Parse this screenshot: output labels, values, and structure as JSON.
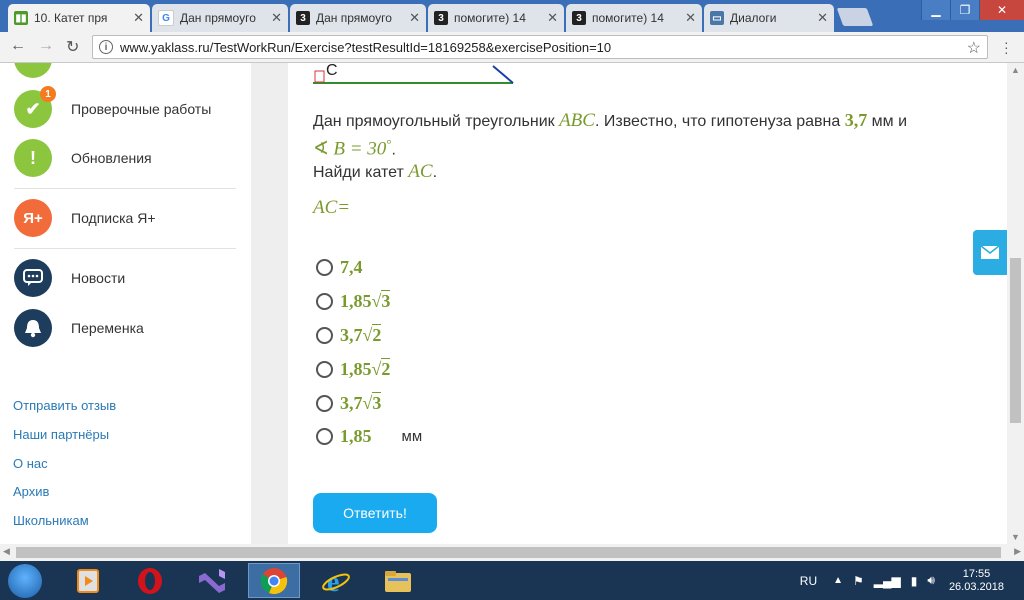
{
  "browser": {
    "tabs": [
      {
        "title": "10. Катет пря",
        "icon": "yaklass-icon",
        "active": true
      },
      {
        "title": "Дан прямоуго",
        "icon": "google-icon"
      },
      {
        "title": "Дан прямоуго",
        "icon": "znanija-icon"
      },
      {
        "title": "помогите) 14",
        "icon": "znanija-icon"
      },
      {
        "title": "помогите) 14",
        "icon": "znanija-icon"
      },
      {
        "title": "Диалоги",
        "icon": "vk-dialog-icon"
      }
    ],
    "url": "www.yaklass.ru/TestWorkRun/Exercise?testResultId=18169258&exercisePosition=10"
  },
  "sidebar": {
    "items": [
      {
        "label": "Проверочные работы",
        "icon": "checkmark-icon",
        "color": "#8cc63f",
        "badge": "1"
      },
      {
        "label": "Обновления",
        "icon": "exclamation-icon",
        "color": "#8cc63f"
      },
      {
        "label": "Подписка Я+",
        "icon": "ya-plus-icon",
        "color": "#f26b3a"
      },
      {
        "label": "Новости",
        "icon": "chat-icon",
        "color": "#1e3d5c"
      },
      {
        "label": "Переменка",
        "icon": "bell-icon",
        "color": "#1e3d5c"
      }
    ],
    "links": [
      "Отправить отзыв",
      "Наши партнёры",
      "О нас",
      "Архив",
      "Школьникам"
    ]
  },
  "exercise": {
    "figure_vertex": "C",
    "question": {
      "line1_text": "Дан прямоугольный треугольник ",
      "triangle": "ABC",
      "line1_mid": ". Известно, что гипотенуза равна ",
      "hyp": "3,7",
      "line1_end": " мм и",
      "angle_sym": "∢",
      "angle_expr": "B = 30",
      "degree": "°",
      "line2_end": ".",
      "line3_text": "Найди катет ",
      "leg": "AC",
      "line3_end": "."
    },
    "answer_label": "AC=",
    "options": [
      {
        "num": "7,4",
        "root": ""
      },
      {
        "num": "1,85",
        "root": "3"
      },
      {
        "num": "3,7",
        "root": "2"
      },
      {
        "num": "1,85",
        "root": "2"
      },
      {
        "num": "3,7",
        "root": "3"
      },
      {
        "num": "1,85",
        "root": ""
      }
    ],
    "unit": "мм",
    "submit_label": "Ответить!"
  },
  "taskbar": {
    "lang": "RU",
    "time": "17:55",
    "date": "26.03.2018"
  },
  "colors": {
    "math_green": "#7a9a2e",
    "button_blue": "#1aaaf0",
    "link_blue": "#2a7ab5",
    "browser_frame": "#3a6fb7"
  }
}
